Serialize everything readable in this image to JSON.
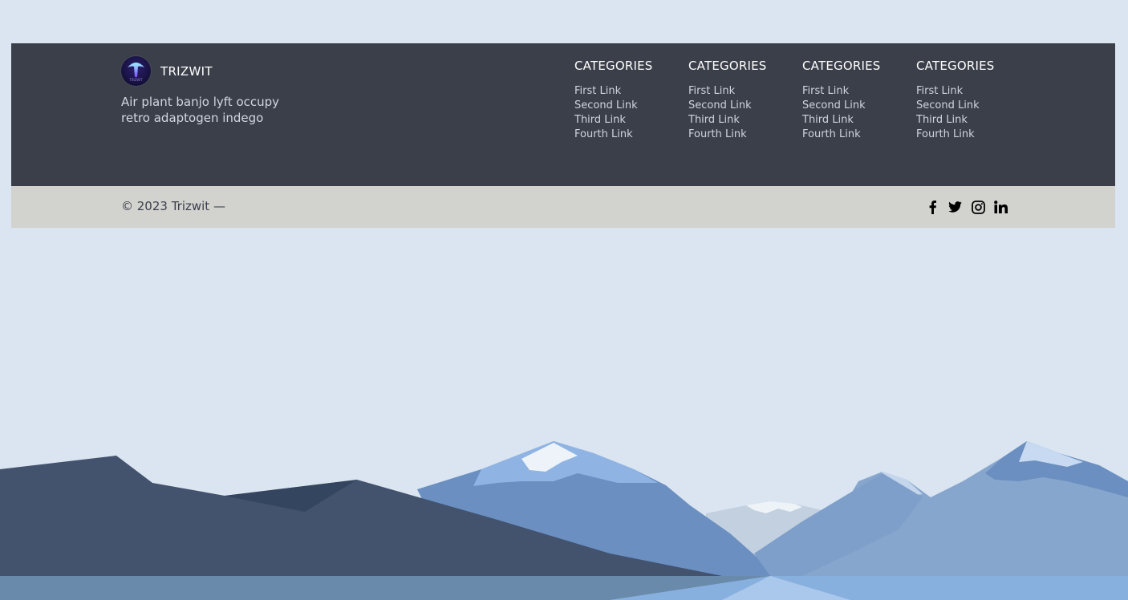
{
  "brand": {
    "name": "TRIZWIT",
    "logo_text": "TRIZWIT",
    "tagline": "Air plant banjo lyft occupy retro adaptogen indego"
  },
  "columns": [
    {
      "title": "CATEGORIES",
      "links": [
        "First Link",
        "Second Link",
        "Third Link",
        "Fourth Link"
      ]
    },
    {
      "title": "CATEGORIES",
      "links": [
        "First Link",
        "Second Link",
        "Third Link",
        "Fourth Link"
      ]
    },
    {
      "title": "CATEGORIES",
      "links": [
        "First Link",
        "Second Link",
        "Third Link",
        "Fourth Link"
      ]
    },
    {
      "title": "CATEGORIES",
      "links": [
        "First Link",
        "Second Link",
        "Third Link",
        "Fourth Link"
      ]
    }
  ],
  "bottom": {
    "copyright": "© 2023 Trizwit —",
    "social": [
      "facebook-icon",
      "twitter-icon",
      "instagram-icon",
      "linkedin-icon"
    ]
  },
  "colors": {
    "page_background": "#dae5f1",
    "footer_background": "#3b3f4a",
    "bottom_bar_background": "#d2d2ce"
  }
}
